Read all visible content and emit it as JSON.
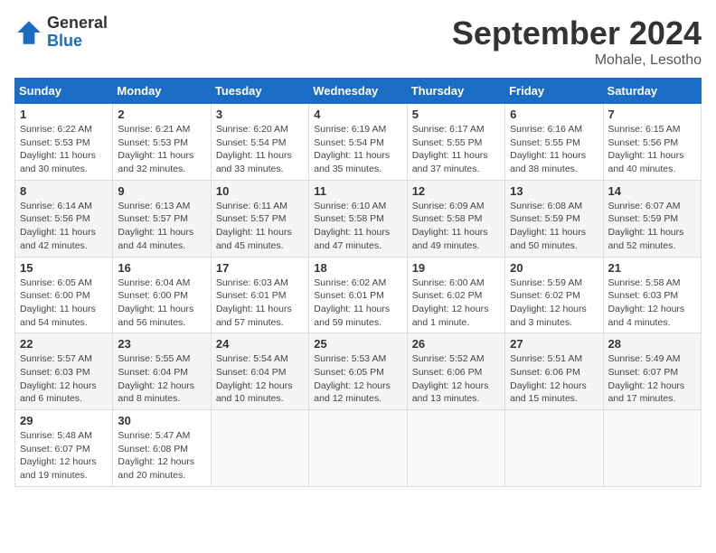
{
  "logo": {
    "general": "General",
    "blue": "Blue"
  },
  "title": "September 2024",
  "location": "Mohale, Lesotho",
  "days_of_week": [
    "Sunday",
    "Monday",
    "Tuesday",
    "Wednesday",
    "Thursday",
    "Friday",
    "Saturday"
  ],
  "weeks": [
    [
      {
        "day": 1,
        "info": "Sunrise: 6:22 AM\nSunset: 5:53 PM\nDaylight: 11 hours\nand 30 minutes."
      },
      {
        "day": 2,
        "info": "Sunrise: 6:21 AM\nSunset: 5:53 PM\nDaylight: 11 hours\nand 32 minutes."
      },
      {
        "day": 3,
        "info": "Sunrise: 6:20 AM\nSunset: 5:54 PM\nDaylight: 11 hours\nand 33 minutes."
      },
      {
        "day": 4,
        "info": "Sunrise: 6:19 AM\nSunset: 5:54 PM\nDaylight: 11 hours\nand 35 minutes."
      },
      {
        "day": 5,
        "info": "Sunrise: 6:17 AM\nSunset: 5:55 PM\nDaylight: 11 hours\nand 37 minutes."
      },
      {
        "day": 6,
        "info": "Sunrise: 6:16 AM\nSunset: 5:55 PM\nDaylight: 11 hours\nand 38 minutes."
      },
      {
        "day": 7,
        "info": "Sunrise: 6:15 AM\nSunset: 5:56 PM\nDaylight: 11 hours\nand 40 minutes."
      }
    ],
    [
      {
        "day": 8,
        "info": "Sunrise: 6:14 AM\nSunset: 5:56 PM\nDaylight: 11 hours\nand 42 minutes."
      },
      {
        "day": 9,
        "info": "Sunrise: 6:13 AM\nSunset: 5:57 PM\nDaylight: 11 hours\nand 44 minutes."
      },
      {
        "day": 10,
        "info": "Sunrise: 6:11 AM\nSunset: 5:57 PM\nDaylight: 11 hours\nand 45 minutes."
      },
      {
        "day": 11,
        "info": "Sunrise: 6:10 AM\nSunset: 5:58 PM\nDaylight: 11 hours\nand 47 minutes."
      },
      {
        "day": 12,
        "info": "Sunrise: 6:09 AM\nSunset: 5:58 PM\nDaylight: 11 hours\nand 49 minutes."
      },
      {
        "day": 13,
        "info": "Sunrise: 6:08 AM\nSunset: 5:59 PM\nDaylight: 11 hours\nand 50 minutes."
      },
      {
        "day": 14,
        "info": "Sunrise: 6:07 AM\nSunset: 5:59 PM\nDaylight: 11 hours\nand 52 minutes."
      }
    ],
    [
      {
        "day": 15,
        "info": "Sunrise: 6:05 AM\nSunset: 6:00 PM\nDaylight: 11 hours\nand 54 minutes."
      },
      {
        "day": 16,
        "info": "Sunrise: 6:04 AM\nSunset: 6:00 PM\nDaylight: 11 hours\nand 56 minutes."
      },
      {
        "day": 17,
        "info": "Sunrise: 6:03 AM\nSunset: 6:01 PM\nDaylight: 11 hours\nand 57 minutes."
      },
      {
        "day": 18,
        "info": "Sunrise: 6:02 AM\nSunset: 6:01 PM\nDaylight: 11 hours\nand 59 minutes."
      },
      {
        "day": 19,
        "info": "Sunrise: 6:00 AM\nSunset: 6:02 PM\nDaylight: 12 hours\nand 1 minute."
      },
      {
        "day": 20,
        "info": "Sunrise: 5:59 AM\nSunset: 6:02 PM\nDaylight: 12 hours\nand 3 minutes."
      },
      {
        "day": 21,
        "info": "Sunrise: 5:58 AM\nSunset: 6:03 PM\nDaylight: 12 hours\nand 4 minutes."
      }
    ],
    [
      {
        "day": 22,
        "info": "Sunrise: 5:57 AM\nSunset: 6:03 PM\nDaylight: 12 hours\nand 6 minutes."
      },
      {
        "day": 23,
        "info": "Sunrise: 5:55 AM\nSunset: 6:04 PM\nDaylight: 12 hours\nand 8 minutes."
      },
      {
        "day": 24,
        "info": "Sunrise: 5:54 AM\nSunset: 6:04 PM\nDaylight: 12 hours\nand 10 minutes."
      },
      {
        "day": 25,
        "info": "Sunrise: 5:53 AM\nSunset: 6:05 PM\nDaylight: 12 hours\nand 12 minutes."
      },
      {
        "day": 26,
        "info": "Sunrise: 5:52 AM\nSunset: 6:06 PM\nDaylight: 12 hours\nand 13 minutes."
      },
      {
        "day": 27,
        "info": "Sunrise: 5:51 AM\nSunset: 6:06 PM\nDaylight: 12 hours\nand 15 minutes."
      },
      {
        "day": 28,
        "info": "Sunrise: 5:49 AM\nSunset: 6:07 PM\nDaylight: 12 hours\nand 17 minutes."
      }
    ],
    [
      {
        "day": 29,
        "info": "Sunrise: 5:48 AM\nSunset: 6:07 PM\nDaylight: 12 hours\nand 19 minutes."
      },
      {
        "day": 30,
        "info": "Sunrise: 5:47 AM\nSunset: 6:08 PM\nDaylight: 12 hours\nand 20 minutes."
      },
      null,
      null,
      null,
      null,
      null
    ]
  ]
}
